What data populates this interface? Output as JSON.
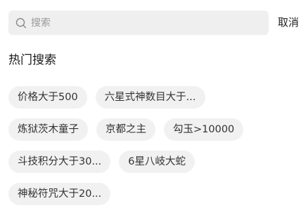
{
  "search": {
    "placeholder": "搜索",
    "value": "",
    "icon": "search-icon"
  },
  "cancel_label": "取消",
  "hot_search": {
    "title": "热门搜索",
    "rows": [
      [
        "价格大于500",
        "六星式神数目大于..."
      ],
      [
        "炼狱茨木童子",
        "京都之主",
        "勾玉>10000"
      ],
      [
        "斗技积分大于30...",
        "6星八岐大蛇"
      ],
      [
        "神秘符咒大于20..."
      ]
    ]
  },
  "colors": {
    "search_bg": "#efefef",
    "tag_bg": "#f1f1f1",
    "text": "#333333"
  }
}
